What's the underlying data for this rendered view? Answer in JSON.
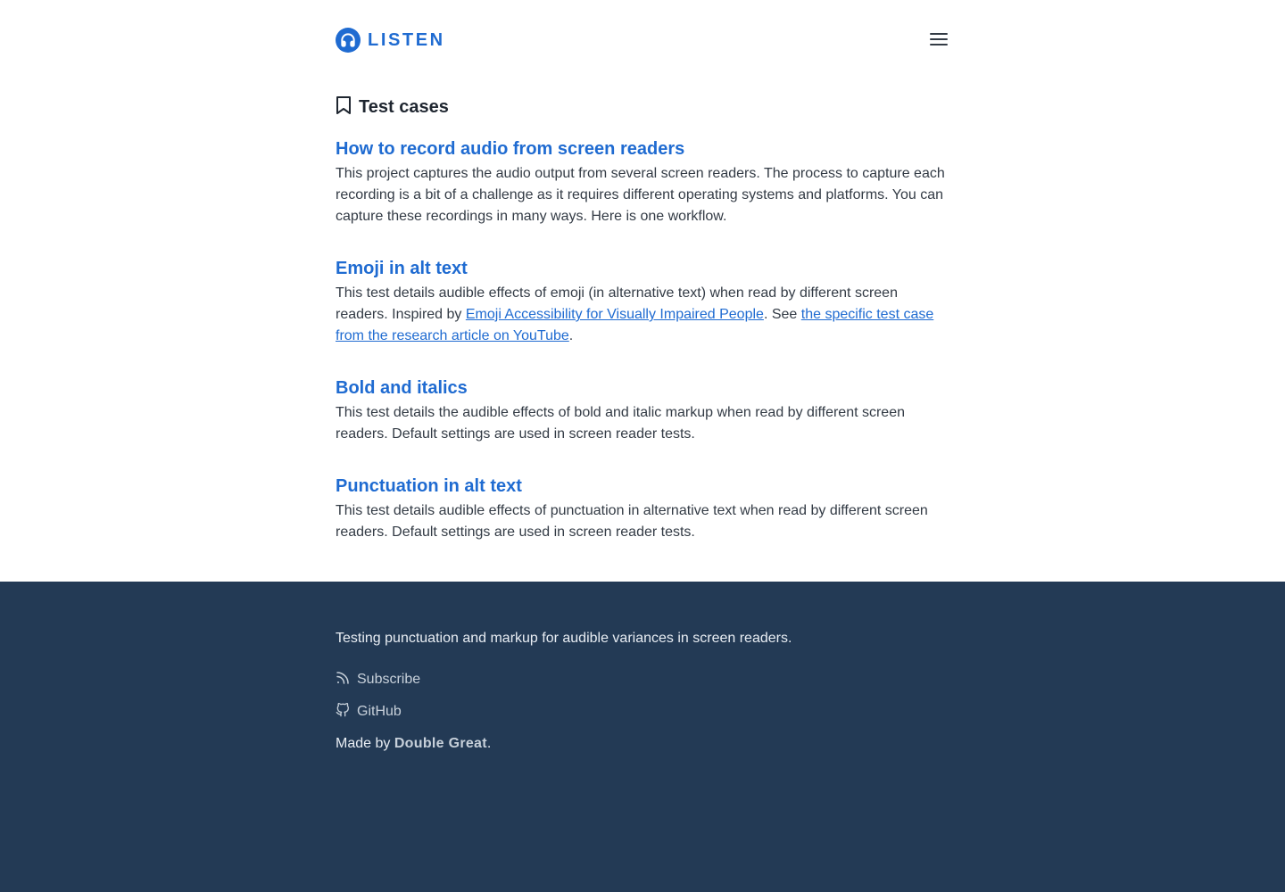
{
  "header": {
    "logo_text": "LISTEN",
    "logo_icon": "headphones-icon",
    "menu_icon": "hamburger-menu-icon"
  },
  "main": {
    "section_icon": "bookmark-icon",
    "section_title": "Test cases",
    "cases": [
      {
        "title": "How to record audio from screen readers",
        "description": "This project captures the audio output from several screen readers. The process to capture each recording is a bit of a challenge as it requires different operating systems and platforms. You can capture these recordings in many ways. Here is one workflow."
      },
      {
        "title": "Emoji in alt text",
        "desc_prefix": "This test details audible effects of emoji (in alternative text) when read by different screen readers. Inspired by ",
        "link1": "Emoji Accessibility for Visually Impaired People",
        "desc_middle": ". See ",
        "link2": "the specific test case from the research article on YouTube",
        "desc_suffix": "."
      },
      {
        "title": "Bold and italics",
        "description": "This test details the audible effects of bold and italic markup when read by different screen readers. Default settings are used in screen reader tests."
      },
      {
        "title": "Punctuation in alt text",
        "description": "This test details audible effects of punctuation in alternative text when read by different screen readers. Default settings are used in screen reader tests."
      }
    ]
  },
  "footer": {
    "tagline": "Testing punctuation and markup for audible variances in screen readers.",
    "links": [
      {
        "icon": "rss-icon",
        "label": "Subscribe"
      },
      {
        "icon": "github-icon",
        "label": "GitHub"
      }
    ],
    "made_by_prefix": "Made by ",
    "made_by_name": "Double Great",
    "made_by_suffix": "."
  },
  "colors": {
    "accent": "#1f6bd1",
    "footer_bg": "#233a55",
    "text": "#333b45"
  }
}
